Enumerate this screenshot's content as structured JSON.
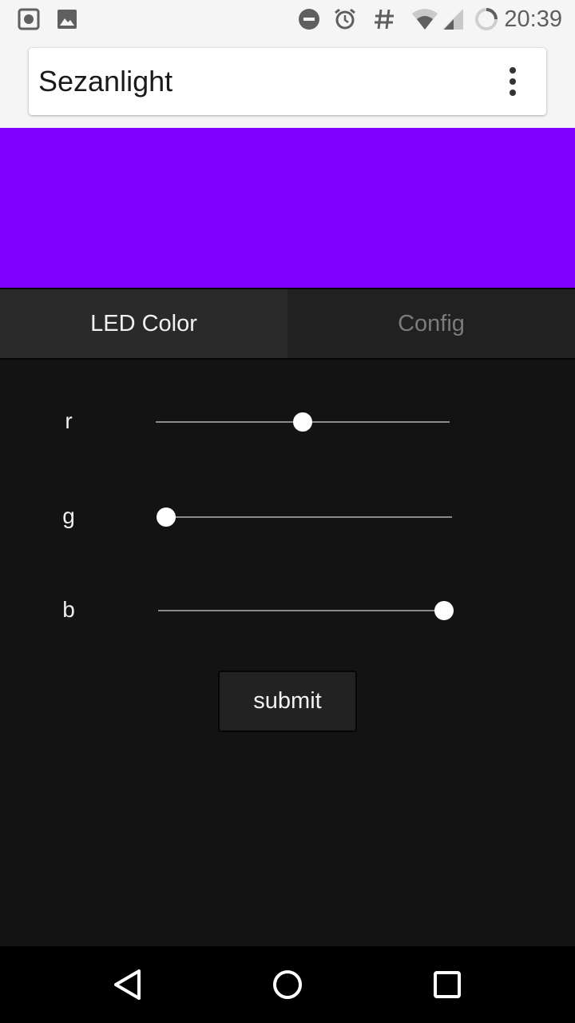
{
  "status_bar": {
    "time": "20:39",
    "icons": [
      "screenshot-icon",
      "image-icon",
      "do-not-disturb-icon",
      "alarm-icon",
      "hash-icon",
      "wifi-icon",
      "cell-signal-icon",
      "battery-charging-icon"
    ]
  },
  "browser": {
    "title": "Sezanlight",
    "menu_icon": "more-vert-icon"
  },
  "preview": {
    "color": "#8000ff"
  },
  "tabs": [
    {
      "label": "LED Color",
      "active": true
    },
    {
      "label": "Config",
      "active": false
    }
  ],
  "sliders": [
    {
      "label": "r",
      "value": 0.5
    },
    {
      "label": "g",
      "value": 0.0
    },
    {
      "label": "b",
      "value": 1.0
    }
  ],
  "submit": {
    "label": "submit"
  },
  "nav": {
    "icons": [
      "back-icon",
      "home-icon",
      "recents-icon"
    ]
  }
}
